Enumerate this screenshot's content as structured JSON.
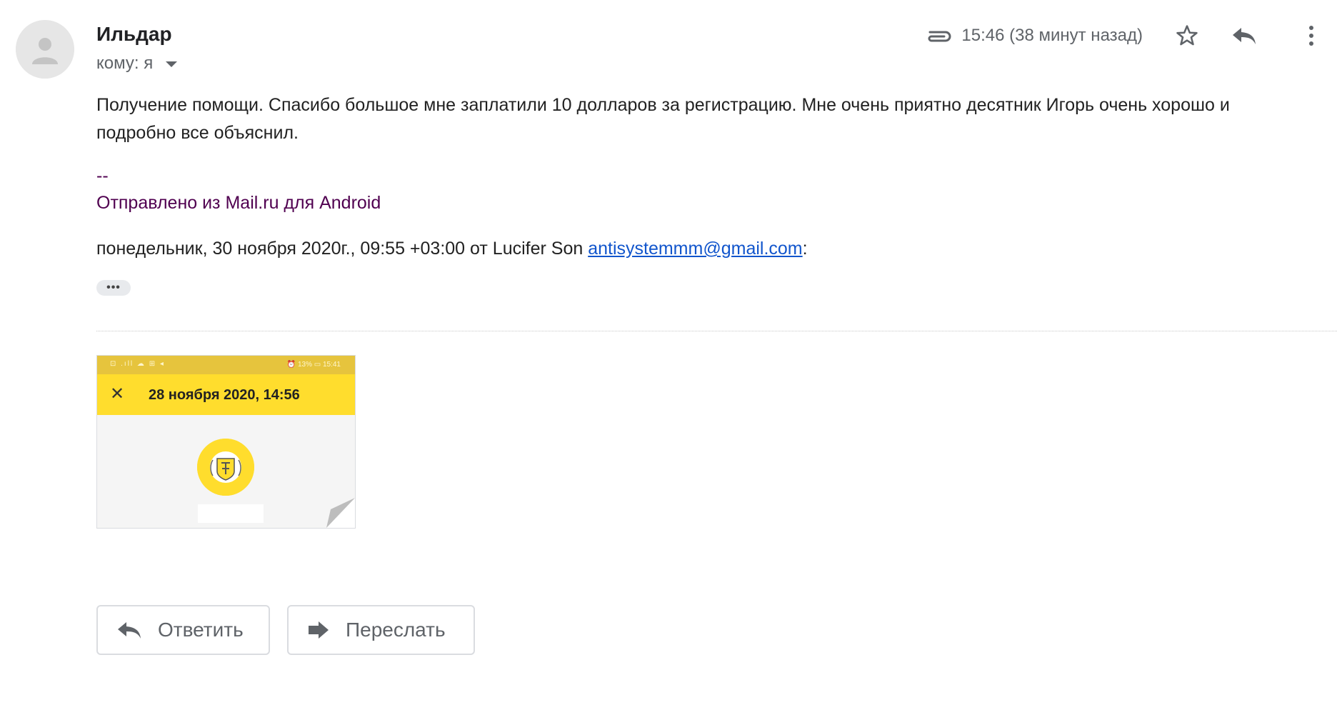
{
  "header": {
    "sender": "Ильдар",
    "to_label": "кому: я",
    "time": "15:46 (38 минут назад)"
  },
  "message": {
    "body": "Получение помощи. Спасибо большое мне заплатили 10 долларов за регистрацию. Мне очень приятно десятник Игорь очень хорошо и подробно все объяснил.",
    "signature_dash": "--",
    "signature": "Отправлено из Mail.ru для Android",
    "quote_prefix": "понедельник, 30 ноября 2020г., 09:55 +03:00 от Lucifer Son ",
    "quote_email": "antisystemmm@gmail.com",
    "quote_suffix": ":",
    "ellipsis": "•••"
  },
  "attachment": {
    "status_left": "⊡ .ıll ☁ ⊞ ◂",
    "status_right": "⏰ 13% ▭ 15:41",
    "close": "✕",
    "title": "28 ноября 2020, 14:56"
  },
  "actions": {
    "reply_label": "Ответить",
    "forward_label": "Переслать"
  },
  "icons": {
    "header": [
      "paperclip-icon",
      "star-icon",
      "reply-icon",
      "more-vert-icon"
    ],
    "buttons": [
      "reply-arrow-icon",
      "forward-arrow-icon"
    ]
  },
  "colors": {
    "signature": "#500050",
    "link": "#1155cc",
    "yellow": "#ffdd2d",
    "muted": "#5f6368"
  }
}
